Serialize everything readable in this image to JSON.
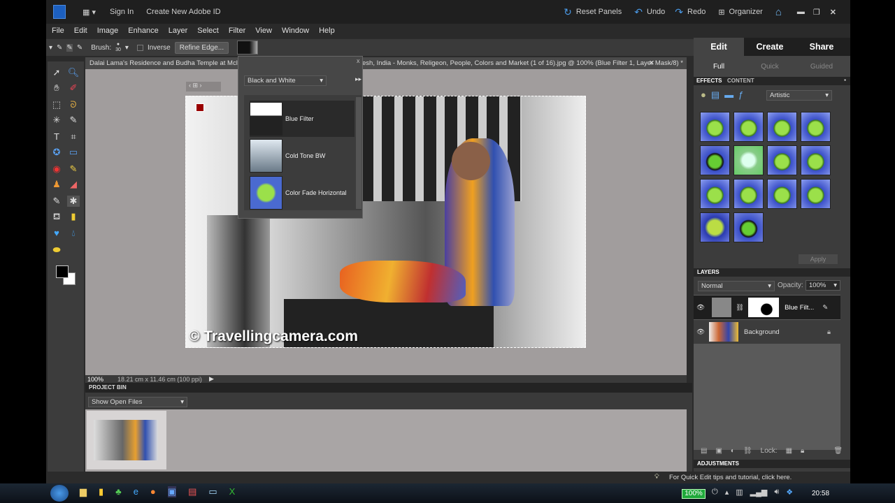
{
  "topbar": {
    "sign_in": "Sign In",
    "create_id": "Create New Adobe ID",
    "reset_panels": "Reset Panels",
    "undo": "Undo",
    "redo": "Redo",
    "organizer": "Organizer"
  },
  "menu": [
    "File",
    "Edit",
    "Image",
    "Enhance",
    "Layer",
    "Select",
    "Filter",
    "View",
    "Window",
    "Help"
  ],
  "options": {
    "brush_label": "Brush:",
    "brush_size": "30",
    "inverse_label": "Inverse",
    "refine_edge": "Refine Edge..."
  },
  "document": {
    "tab_left": "Dalai Lama's Residence and Budha Temple at Mcleodg",
    "tab_right": "esh, India - Monks, Religeon, People, Colors and Market (1 of 16).jpg @ 100% (Blue Filter 1, Layer Mask/8) *",
    "watermark": "© Travellingcamera.com"
  },
  "filter_popup": {
    "category": "Black and White",
    "items": [
      {
        "label": "Blue Filter",
        "selected": true
      },
      {
        "label": "Cold Tone BW",
        "selected": false
      },
      {
        "label": "Color Fade Horizontal",
        "selected": false
      }
    ]
  },
  "status": {
    "zoom": "100%",
    "dimensions": "18.21 cm x 11.46 cm (100 ppi)"
  },
  "project_bin": {
    "title": "PROJECT BIN",
    "filter": "Show Open Files"
  },
  "right_panel": {
    "modes": [
      "Edit",
      "Create",
      "Share"
    ],
    "active_mode": "Edit",
    "submodes": [
      "Full",
      "Quick",
      "Guided"
    ],
    "active_submode": "Full",
    "effects": {
      "tabs": [
        "EFFECTS",
        "CONTENT"
      ],
      "category": "Artistic",
      "apply": "Apply",
      "thumb_count": 14
    },
    "layers": {
      "title": "LAYERS",
      "blend": "Normal",
      "opacity_label": "Opacity:",
      "opacity": "100%",
      "items": [
        {
          "name": "Blue Filt...",
          "visible": true
        },
        {
          "name": "Background",
          "visible": true,
          "locked": true
        }
      ],
      "lock_label": "Lock:"
    },
    "adjustments": "ADJUSTMENTS"
  },
  "tip": "For Quick Edit tips and tutorial, click here.",
  "taskbar": {
    "battery": "100%",
    "clock": "20:58"
  },
  "colors": {
    "accent": "#3a88d8",
    "canvas_bg": "#a19d9d",
    "battery": "#1fa83a"
  }
}
